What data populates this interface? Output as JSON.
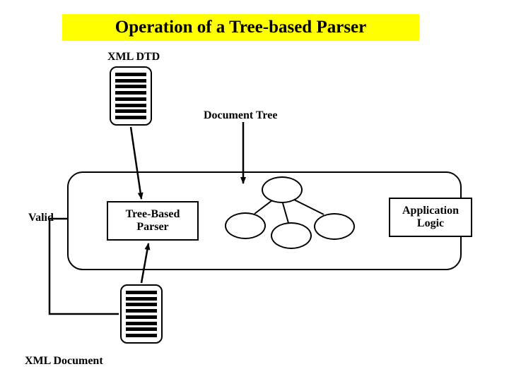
{
  "title": "Operation of a Tree-based Parser",
  "labels": {
    "dtd": "XML DTD",
    "doctree": "Document Tree",
    "valid": "Valid",
    "xmldoc": "XML Document"
  },
  "boxes": {
    "parser": "Tree-Based\nParser",
    "app": "Application\nLogic"
  }
}
